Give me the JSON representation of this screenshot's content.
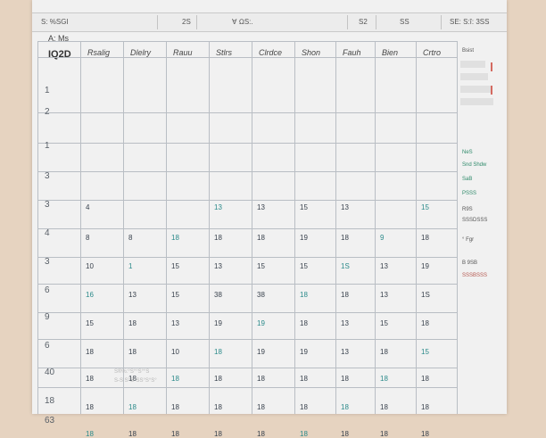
{
  "topbar": {
    "seg1": "S: %SGI",
    "seg2": "2S",
    "seg3": "∀  ΩS:.",
    "seg4": "S2",
    "seg5": "SS",
    "seg6": "SE: S:î: 3SS"
  },
  "corner_label": "A: Ms",
  "year_label": "IQ2D",
  "columns": [
    "Rsalig",
    "Dlelry",
    "Rauu",
    "Stlrs",
    "Clrdce",
    "Shon",
    "Fauh",
    "Bien",
    "Crtro"
  ],
  "row_labels": [
    "1",
    "2",
    "1",
    "3",
    "3",
    "4",
    "3",
    "6",
    "9",
    "6",
    "40",
    "18",
    "63"
  ],
  "rows": [
    [
      "",
      "",
      "",
      "",
      "",
      "",
      "",
      "",
      ""
    ],
    [
      "",
      "",
      "",
      "",
      "",
      "",
      "",
      "",
      ""
    ],
    [
      "4",
      "",
      "",
      "13",
      "13",
      "15",
      "13",
      "",
      "15"
    ],
    [
      "8",
      "8",
      "18",
      "18",
      "18",
      "19",
      "18",
      "9",
      "18"
    ],
    [
      "10",
      "1",
      "15",
      "13",
      "15",
      "15",
      "1S",
      "13",
      "19"
    ],
    [
      "16",
      "13",
      "15",
      "38",
      "38",
      "18",
      "18",
      "13",
      "1S"
    ],
    [
      "15",
      "18",
      "13",
      "19",
      "19",
      "18",
      "13",
      "15",
      "18"
    ],
    [
      "18",
      "18",
      "10",
      "18",
      "19",
      "19",
      "13",
      "18",
      "15"
    ],
    [
      "18",
      "18",
      "18",
      "18",
      "18",
      "18",
      "18",
      "18",
      "18"
    ],
    [
      "18",
      "18",
      "18",
      "18",
      "18",
      "18",
      "18",
      "18",
      "18"
    ],
    [
      "18",
      "18",
      "18",
      "18",
      "18",
      "18",
      "18",
      "18",
      "18"
    ]
  ],
  "sidebar_notes": [
    {
      "text": "Bsist",
      "style": ""
    },
    {
      "text": "NeS",
      "style": "green"
    },
    {
      "text": "Snd Shdw",
      "style": "green"
    },
    {
      "text": "SaB",
      "style": "green"
    },
    {
      "text": "PSSS",
      "style": "green"
    },
    {
      "text": "R9S",
      "style": ""
    },
    {
      "text": "SSSDSSS",
      "style": ""
    },
    {
      "text": "° Fgr",
      "style": ""
    },
    {
      "text": "B 9SB",
      "style": ""
    },
    {
      "text": "SSSBSSS",
      "style": "red"
    }
  ],
  "faint_notes": [
    "S®%:°S°°S°°S",
    "S-S S°S°SS°S°S°"
  ],
  "colors": {
    "page": "#f1f1f1",
    "grid": "#b9bec4",
    "accent": "#2b8a8a",
    "warn": "#d46a60"
  }
}
